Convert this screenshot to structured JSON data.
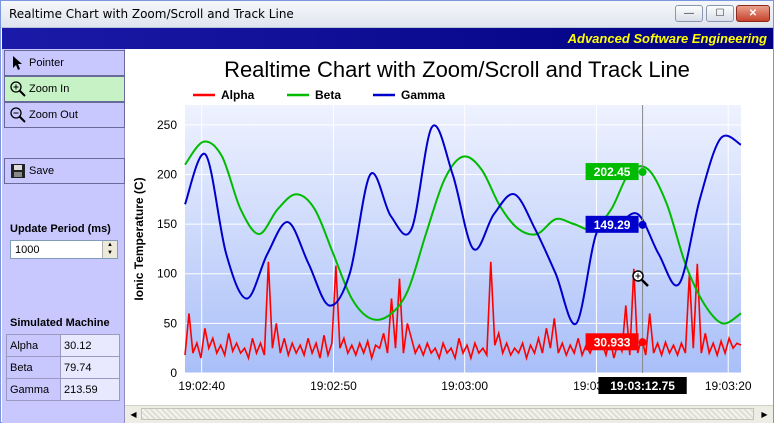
{
  "window": {
    "title": "Realtime Chart with Zoom/Scroll and Track Line",
    "banner": "Advanced Software Engineering",
    "controls": {
      "minimize": "—",
      "maximize": "☐",
      "close": "✕"
    }
  },
  "toolbar": {
    "pointer": "Pointer",
    "zoom_in": "Zoom In",
    "zoom_out": "Zoom Out",
    "save": "Save"
  },
  "update_period": {
    "label": "Update Period (ms)",
    "value": "1000"
  },
  "simulated_machine": {
    "heading": "Simulated Machine",
    "rows": [
      {
        "name": "Alpha",
        "value": "30.12"
      },
      {
        "name": "Beta",
        "value": "79.74"
      },
      {
        "name": "Gamma",
        "value": "213.59"
      }
    ]
  },
  "chart_data": {
    "type": "line",
    "title": "Realtime Chart with Zoom/Scroll and Track Line",
    "ylabel": "Ionic Temperature (C)",
    "xlabel": "",
    "ylim": [
      0,
      270
    ],
    "yticks": [
      "0",
      "50",
      "100",
      "150",
      "200",
      "250"
    ],
    "xticks": [
      "19:02:40",
      "19:02:50",
      "19:03:00",
      "19:03:10",
      "19:03:20"
    ],
    "grid": true,
    "legend_position": "top-left",
    "series": [
      {
        "name": "Alpha",
        "color": "#ff0000",
        "values": [
          18,
          60,
          20,
          30,
          15,
          45,
          25,
          35,
          20,
          28,
          18,
          40,
          22,
          30,
          20,
          25,
          15,
          35,
          20,
          30,
          18,
          112,
          25,
          50,
          20,
          35,
          18,
          30,
          20,
          28,
          18,
          35,
          20,
          30,
          15,
          38,
          18,
          30,
          108,
          25,
          35,
          20,
          28,
          18,
          30,
          20,
          32,
          15,
          28,
          25,
          40,
          20,
          75,
          25,
          95,
          20,
          50,
          35,
          20,
          28,
          18,
          30,
          20,
          25,
          15,
          30,
          20,
          25,
          15,
          35,
          20,
          28,
          15,
          30,
          20,
          25,
          18,
          112,
          28,
          40,
          20,
          30,
          18,
          25,
          20,
          30,
          15,
          28,
          20,
          35,
          20,
          45,
          25,
          55,
          20,
          30,
          18,
          28,
          20,
          35,
          18,
          28,
          20,
          30,
          25,
          30,
          18,
          35,
          15,
          30,
          22,
          68,
          18,
          105,
          20,
          35,
          18,
          60,
          20,
          30,
          18,
          30.933,
          20,
          28,
          18,
          30,
          20,
          100,
          25,
          110,
          20,
          40,
          20,
          30,
          18,
          32,
          20,
          35,
          25,
          30,
          28
        ]
      },
      {
        "name": "Beta",
        "color": "#00bb00",
        "values": [
          210,
          233,
          218,
          165,
          140,
          165,
          180,
          165,
          120,
          75,
          55,
          58,
          82,
          140,
          195,
          218,
          205,
          168,
          145,
          140,
          155,
          150,
          145,
          165,
          202.45,
          205,
          170,
          110,
          70,
          50,
          60
        ]
      },
      {
        "name": "Gamma",
        "color": "#0000cc",
        "values": [
          170,
          220,
          120,
          75,
          120,
          152,
          110,
          68,
          100,
          200,
          158,
          145,
          248,
          200,
          125,
          160,
          180,
          145,
          100,
          50,
          142,
          149.29,
          160,
          120,
          90,
          175,
          236,
          230
        ]
      }
    ],
    "track_line": {
      "time": "19:03:12.75",
      "labels": {
        "Alpha": "30.933",
        "Beta": "202.45",
        "Gamma": "149.29"
      }
    }
  }
}
